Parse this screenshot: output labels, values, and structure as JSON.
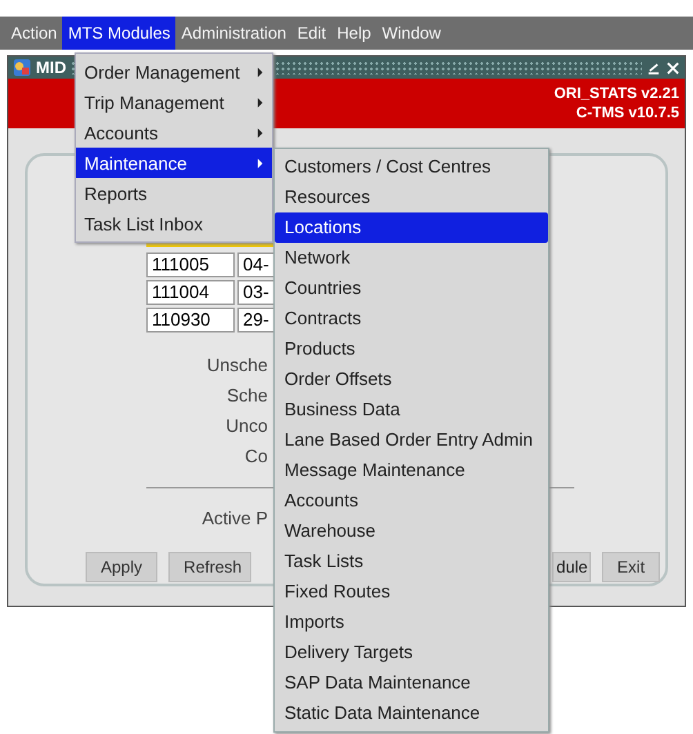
{
  "menubar": [
    {
      "label": "Action",
      "selected": false
    },
    {
      "label": "MTS Modules",
      "selected": true
    },
    {
      "label": "Administration",
      "selected": false
    },
    {
      "label": "Edit",
      "selected": false
    },
    {
      "label": "Help",
      "selected": false
    },
    {
      "label": "Window",
      "selected": false
    }
  ],
  "window": {
    "title": "MID",
    "versions": [
      "ORI_STATS v2.21",
      "C-TMS v10.7.5"
    ]
  },
  "table": {
    "rows": [
      {
        "id": "111005",
        "date": "04-"
      },
      {
        "id": "111004",
        "date": "03-"
      },
      {
        "id": "110930",
        "date": "29-"
      }
    ]
  },
  "labels": [
    "Unsche",
    "Sche",
    "Unco",
    "Co"
  ],
  "active_label": "Active P",
  "buttons": [
    "Apply",
    "Refresh",
    "dule",
    "Exit"
  ],
  "menu": {
    "items": [
      {
        "label": "Order Management",
        "submenu": true,
        "selected": false
      },
      {
        "label": "Trip Management",
        "submenu": true,
        "selected": false
      },
      {
        "label": "Accounts",
        "submenu": true,
        "selected": false
      },
      {
        "label": "Maintenance",
        "submenu": true,
        "selected": true
      },
      {
        "label": "Reports",
        "submenu": false,
        "selected": false
      },
      {
        "label": "Task List Inbox",
        "submenu": false,
        "selected": false
      }
    ]
  },
  "submenu": {
    "items": [
      {
        "label": "Customers / Cost Centres",
        "selected": false
      },
      {
        "label": "Resources",
        "selected": false
      },
      {
        "label": "Locations",
        "selected": true
      },
      {
        "label": "Network",
        "selected": false
      },
      {
        "label": "Countries",
        "selected": false
      },
      {
        "label": "Contracts",
        "selected": false
      },
      {
        "label": "Products",
        "selected": false
      },
      {
        "label": "Order Offsets",
        "selected": false
      },
      {
        "label": "Business Data",
        "selected": false
      },
      {
        "label": "Lane Based Order Entry Admin",
        "selected": false
      },
      {
        "label": "Message Maintenance",
        "selected": false
      },
      {
        "label": "Accounts",
        "selected": false
      },
      {
        "label": "Warehouse",
        "selected": false
      },
      {
        "label": "Task Lists",
        "selected": false
      },
      {
        "label": "Fixed Routes",
        "selected": false
      },
      {
        "label": "Imports",
        "selected": false
      },
      {
        "label": "Delivery Targets",
        "selected": false
      },
      {
        "label": "SAP Data Maintenance",
        "selected": false
      },
      {
        "label": "Static Data Maintenance",
        "selected": false
      }
    ]
  }
}
